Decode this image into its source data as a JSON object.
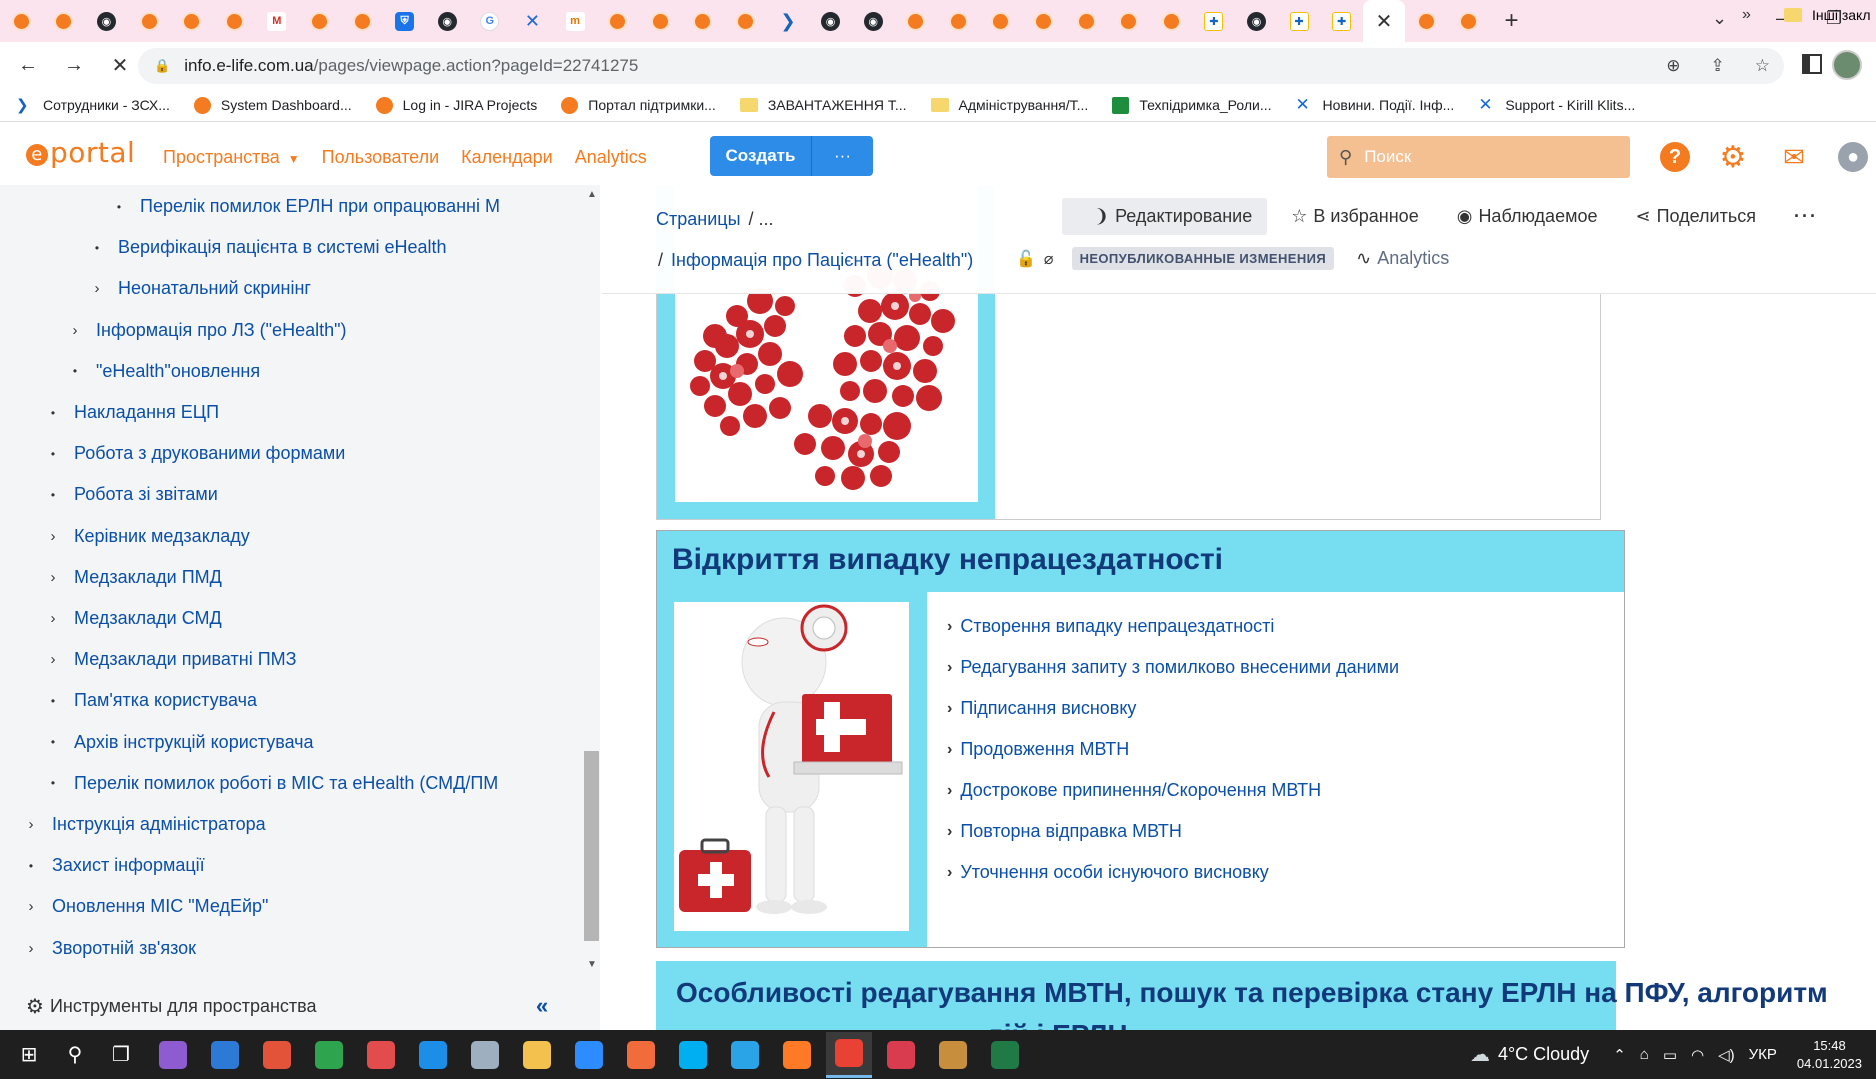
{
  "browser": {
    "tabs_count": 36,
    "active_tab_close": "✕",
    "new_tab": "+",
    "url_host": "info.e-life.com.ua",
    "url_path": "/pages/viewpage.action?pageId=22741275",
    "bookmarks": [
      {
        "label": "Сотрудники - ЗСХ...",
        "icon": "arrow-icon"
      },
      {
        "label": "System Dashboard...",
        "icon": "eportal-icon"
      },
      {
        "label": "Log in - JIRA Projects",
        "icon": "eportal-icon"
      },
      {
        "label": "Портал підтримки...",
        "icon": "eportal-icon"
      },
      {
        "label": "ЗАВАНТАЖЕННЯ Т...",
        "icon": "folder-icon"
      },
      {
        "label": "Адміністрування/Т...",
        "icon": "folder-icon"
      },
      {
        "label": "Техпідримка_Роли...",
        "icon": "plus-icon"
      },
      {
        "label": "Новини. Події. Інф...",
        "icon": "confluence-icon"
      },
      {
        "label": "Support - Kirill Klits...",
        "icon": "confluence-icon"
      }
    ],
    "bookmarks_more": "»",
    "bookmarks_other": "Інші закл"
  },
  "header": {
    "logo": "portal",
    "logo_mark": "e",
    "nav": [
      "Пространства",
      "Пользователи",
      "Календари",
      "Analytics"
    ],
    "create": "Создать",
    "create_more": "···",
    "search_placeholder": "Поиск",
    "help": "?"
  },
  "sidebar": {
    "items": [
      {
        "label": "Перелік помилок ЕРЛН при опрацюванні М",
        "marker": "•",
        "indent": 3
      },
      {
        "label": "Верифікація пацієнта в системі eHealth",
        "marker": "•",
        "indent": 2
      },
      {
        "label": "Неонатальний скринінг",
        "marker": "›",
        "indent": 2
      },
      {
        "label": "Інформація про ЛЗ (\"eHealth\")",
        "marker": "›",
        "indent": 1
      },
      {
        "label": "\"eHealth\"оновлення",
        "marker": "•",
        "indent": 1
      },
      {
        "label": "Накладання ЕЦП",
        "marker": "•",
        "indent": 0
      },
      {
        "label": "Робота з друкованими формами",
        "marker": "•",
        "indent": 0
      },
      {
        "label": "Робота зі звітами",
        "marker": "•",
        "indent": 0
      },
      {
        "label": "Керівник медзакладу",
        "marker": "›",
        "indent": 0
      },
      {
        "label": "Медзаклади ПМД",
        "marker": "›",
        "indent": 0
      },
      {
        "label": "Медзаклади СМД",
        "marker": "›",
        "indent": 0
      },
      {
        "label": "Медзаклади приватні ПМЗ",
        "marker": "›",
        "indent": 0
      },
      {
        "label": "Пам'ятка користувача",
        "marker": "•",
        "indent": 0
      },
      {
        "label": "Архів інструкцій користувача",
        "marker": "•",
        "indent": 0
      },
      {
        "label": "Перелік помилок роботі в МІС та eHealth (СМД/ПМ",
        "marker": "•",
        "indent": 0
      },
      {
        "label": "Інструкція адміністратора",
        "marker": "›",
        "indent": -1
      },
      {
        "label": "Захист інформації",
        "marker": "•",
        "indent": -1
      },
      {
        "label": "Оновлення МІС \"МедЕйр\"",
        "marker": "›",
        "indent": -1
      },
      {
        "label": "Зворотній зв'язок",
        "marker": "›",
        "indent": -1
      }
    ],
    "tools": "Инструменты для пространства",
    "collapse": "«"
  },
  "pagebar": {
    "crumb_pages": "Страницы",
    "crumb_sep": "/",
    "crumb_ellipsis": "...",
    "crumb_current": "Інформація про Пацієнта (\"eHealth\")",
    "edit": "Редактирование",
    "favorite": "В избранное",
    "watch": "Наблюдаемое",
    "share": "Поделиться",
    "more": "···",
    "unpublished": "НЕОПУБЛИКОВАННЫЕ ИЗМЕНЕНИЯ",
    "analytics": "Analytics"
  },
  "content": {
    "section_title": "Відкриття  випадку непрацездатності",
    "links": [
      "Створення випадку непрацездатності",
      "Редагування запиту з помилково внесеними даними",
      "Підписання висновку",
      "Продовження МВТН",
      "Дострокове припинення/Скорочення МВТН",
      "Повторна відправка МВТН",
      "Уточнення особи існуючого висновку"
    ],
    "section2_title": "Особливості редагування МВТН, пошук та перевірка стану ЕРЛН на ПФУ,  алгоритм",
    "section2_line2": "дій      і                       ЕРЛН"
  },
  "taskbar": {
    "weather": "4°C  Cloudy",
    "lang": "УКР",
    "time": "15:48",
    "date": "04.01.2023"
  },
  "colors": {
    "accent": "#f47b20",
    "link": "#0b4fa6",
    "cyan": "#76def0",
    "title": "#123a7a"
  }
}
